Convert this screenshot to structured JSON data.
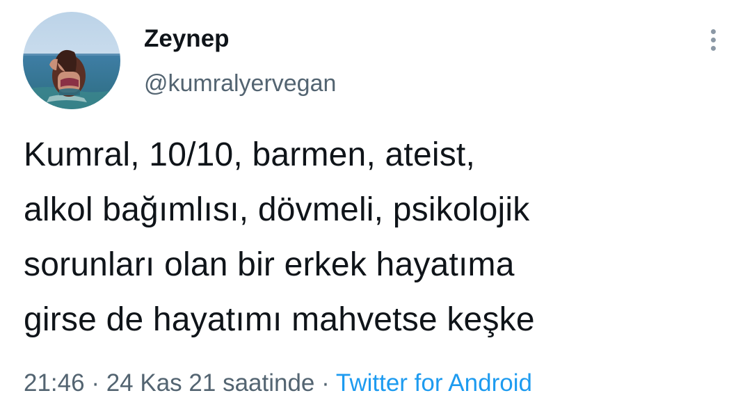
{
  "tweet": {
    "author": {
      "display_name": "Zeynep",
      "handle": "@kumralyervegan"
    },
    "text_lines": [
      "Kumral, 10/10, barmen, ateist,",
      "alkol bağımlısı, dövmeli, psikolojik",
      "sorunları olan bir erkek hayatıma",
      "girse de hayatımı mahvetse keşke"
    ],
    "meta": {
      "time": "21:46",
      "separator": "·",
      "date": "24 Kas 21 saatinde",
      "source": "Twitter for Android"
    },
    "icons": {
      "more": "more-vertical-icon"
    },
    "colors": {
      "text": "#0f1419",
      "secondary": "#536471",
      "link": "#1d9bf0",
      "more_icon": "#8b98a5"
    }
  }
}
